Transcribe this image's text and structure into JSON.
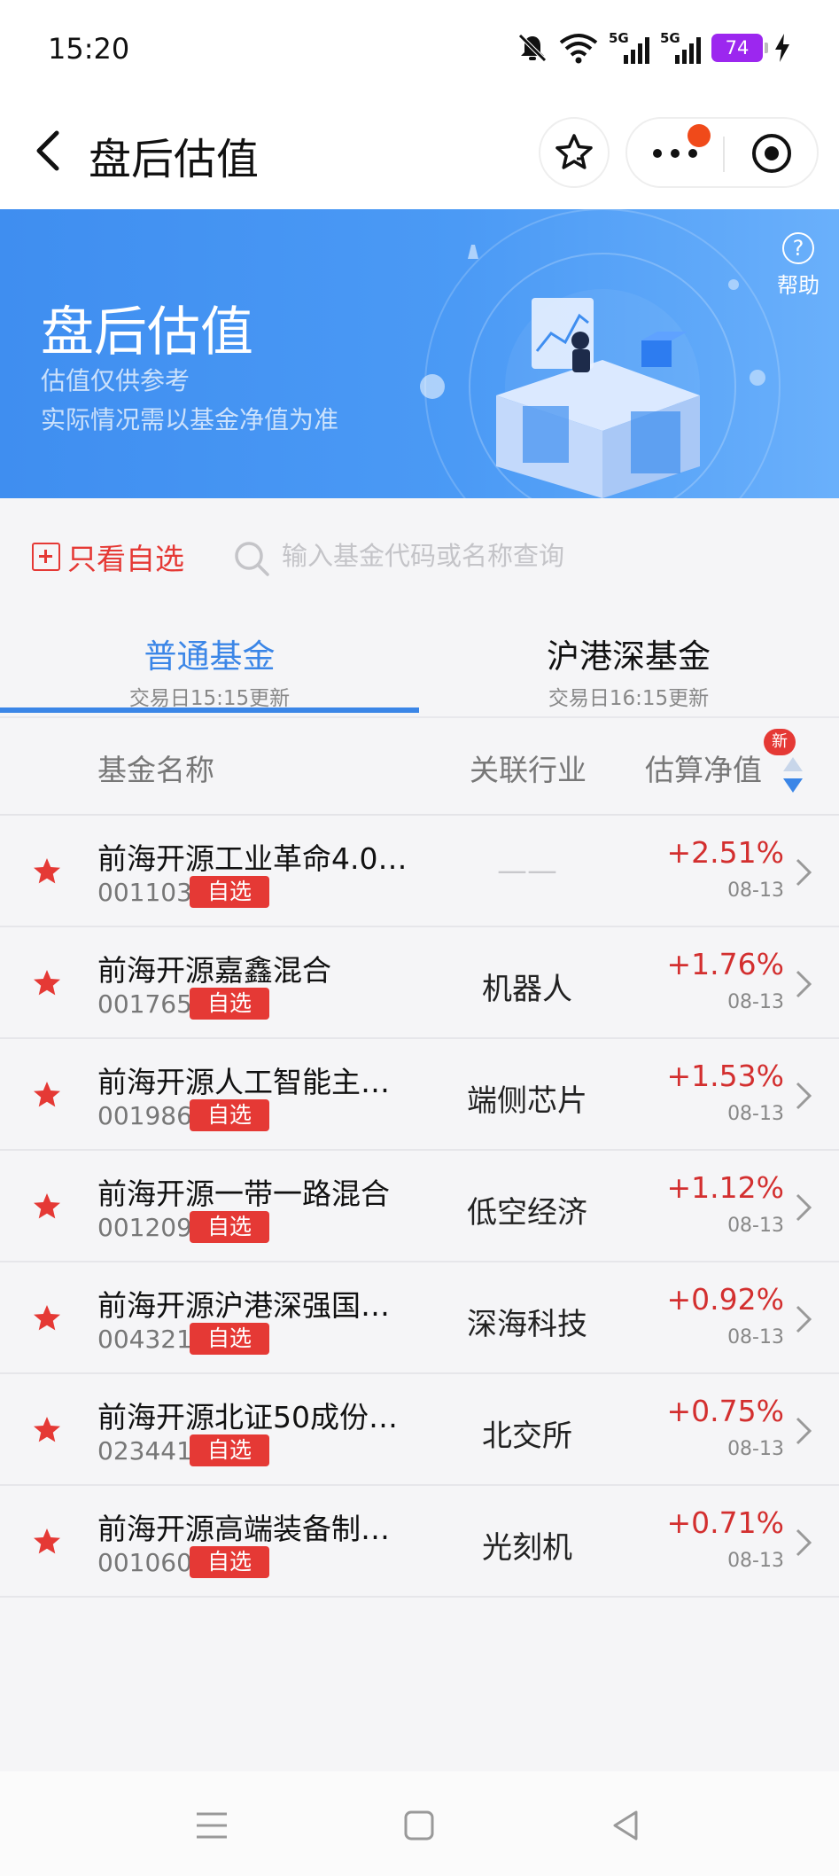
{
  "status_bar": {
    "time": "15:20",
    "signal_label": "5G",
    "battery": "74"
  },
  "header": {
    "title": "盘后估值"
  },
  "banner": {
    "title": "盘后估值",
    "subtitle_line1": "估值仅供参考",
    "subtitle_line2": "实际情况需以基金净值为准",
    "help_label": "帮助",
    "help_symbol": "?"
  },
  "filter": {
    "only_favorites_label": "只看自选"
  },
  "search": {
    "placeholder": "输入基金代码或名称查询",
    "value": ""
  },
  "tabs": [
    {
      "label": "普通基金",
      "sub": "交易日15:15更新",
      "active": true
    },
    {
      "label": "沪港深基金",
      "sub": "交易日16:15更新",
      "active": false
    }
  ],
  "columns": {
    "name": "基金名称",
    "industry": "关联行业",
    "nav": "估算净值",
    "new_badge": "新"
  },
  "favorite_badge": "自选",
  "funds": [
    {
      "name": "前海开源工业革命4.0…",
      "code": "001103",
      "industry": "——",
      "change": "+2.51%",
      "date": "08-13"
    },
    {
      "name": "前海开源嘉鑫混合",
      "code": "001765",
      "industry": "机器人",
      "change": "+1.76%",
      "date": "08-13"
    },
    {
      "name": "前海开源人工智能主…",
      "code": "001986",
      "industry": "端侧芯片",
      "change": "+1.53%",
      "date": "08-13"
    },
    {
      "name": "前海开源一带一路混合",
      "code": "001209",
      "industry": "低空经济",
      "change": "+1.12%",
      "date": "08-13"
    },
    {
      "name": "前海开源沪港深强国…",
      "code": "004321",
      "industry": "深海科技",
      "change": "+0.92%",
      "date": "08-13"
    },
    {
      "name": "前海开源北证50成份…",
      "code": "023441",
      "industry": "北交所",
      "change": "+0.75%",
      "date": "08-13"
    },
    {
      "name": "前海开源高端装备制…",
      "code": "001060",
      "industry": "光刻机",
      "change": "+0.71%",
      "date": "08-13"
    }
  ],
  "colors": {
    "accent_blue": "#3b86e7",
    "up_red": "#d32f2f",
    "badge_red": "#e53935"
  }
}
